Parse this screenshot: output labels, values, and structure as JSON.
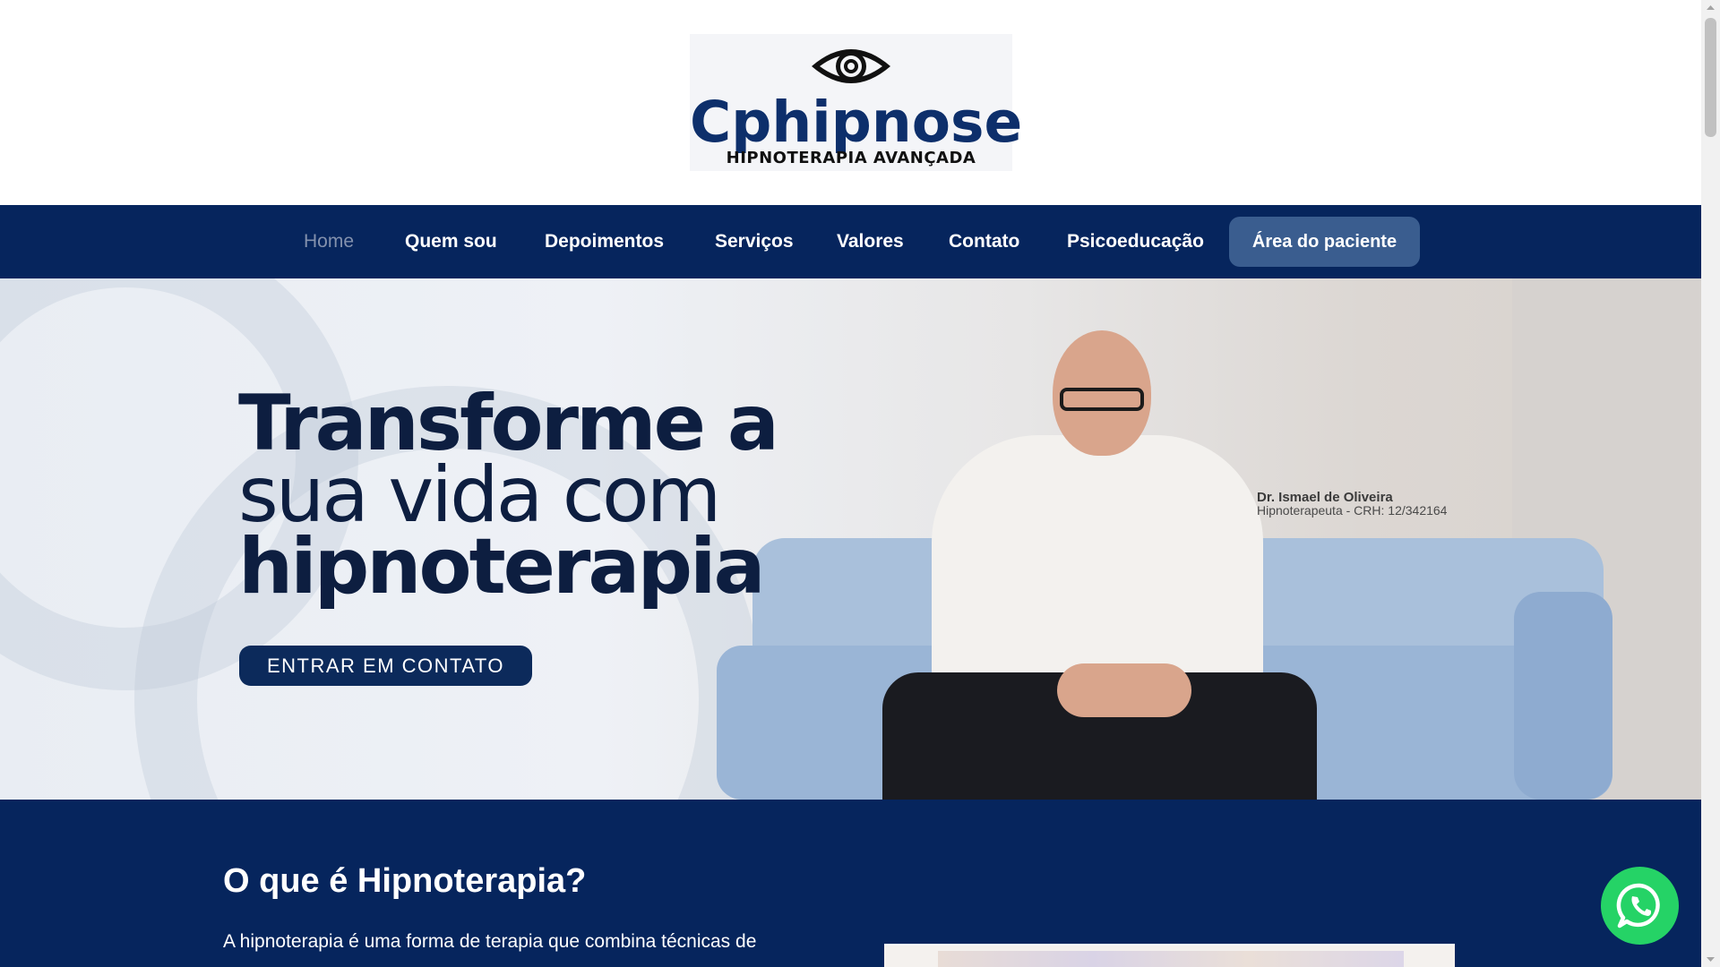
{
  "header": {
    "logo": {
      "brand": "Cphipnose",
      "tagline": "HIPNOTERAPIA AVANÇADA",
      "icon": "eye-icon"
    }
  },
  "nav": {
    "items": [
      {
        "label": "Home",
        "active": true
      },
      {
        "label": "Quem sou",
        "active": false
      },
      {
        "label": "Depoimentos",
        "active": false
      },
      {
        "label": "Serviços",
        "active": false
      },
      {
        "label": "Valores",
        "active": false
      },
      {
        "label": "Contato",
        "active": false
      },
      {
        "label": "Psicoeducação",
        "active": false
      }
    ],
    "cta_label": "Área do paciente"
  },
  "hero": {
    "headline_line1": "Transforme a",
    "headline_line2": "sua vida com",
    "headline_line3": "hipnoterapia",
    "button_label": "ENTRAR EM CONTATO",
    "doctor_name": "Dr. Ismael de Oliveira",
    "doctor_credential": "Hipnoterapeuta - CRH: 12/342164"
  },
  "section": {
    "title": "O que é Hipnoterapia?",
    "text": "A hipnoterapia é uma forma de terapia que combina técnicas de"
  },
  "floating": {
    "whatsapp_icon": "whatsapp-icon"
  },
  "colors": {
    "navy": "#06255d",
    "nav_active": "#8391ad",
    "cta_button": "#3a5d8f",
    "hero_text": "#0d1e40",
    "whatsapp_green": "#25d366"
  }
}
